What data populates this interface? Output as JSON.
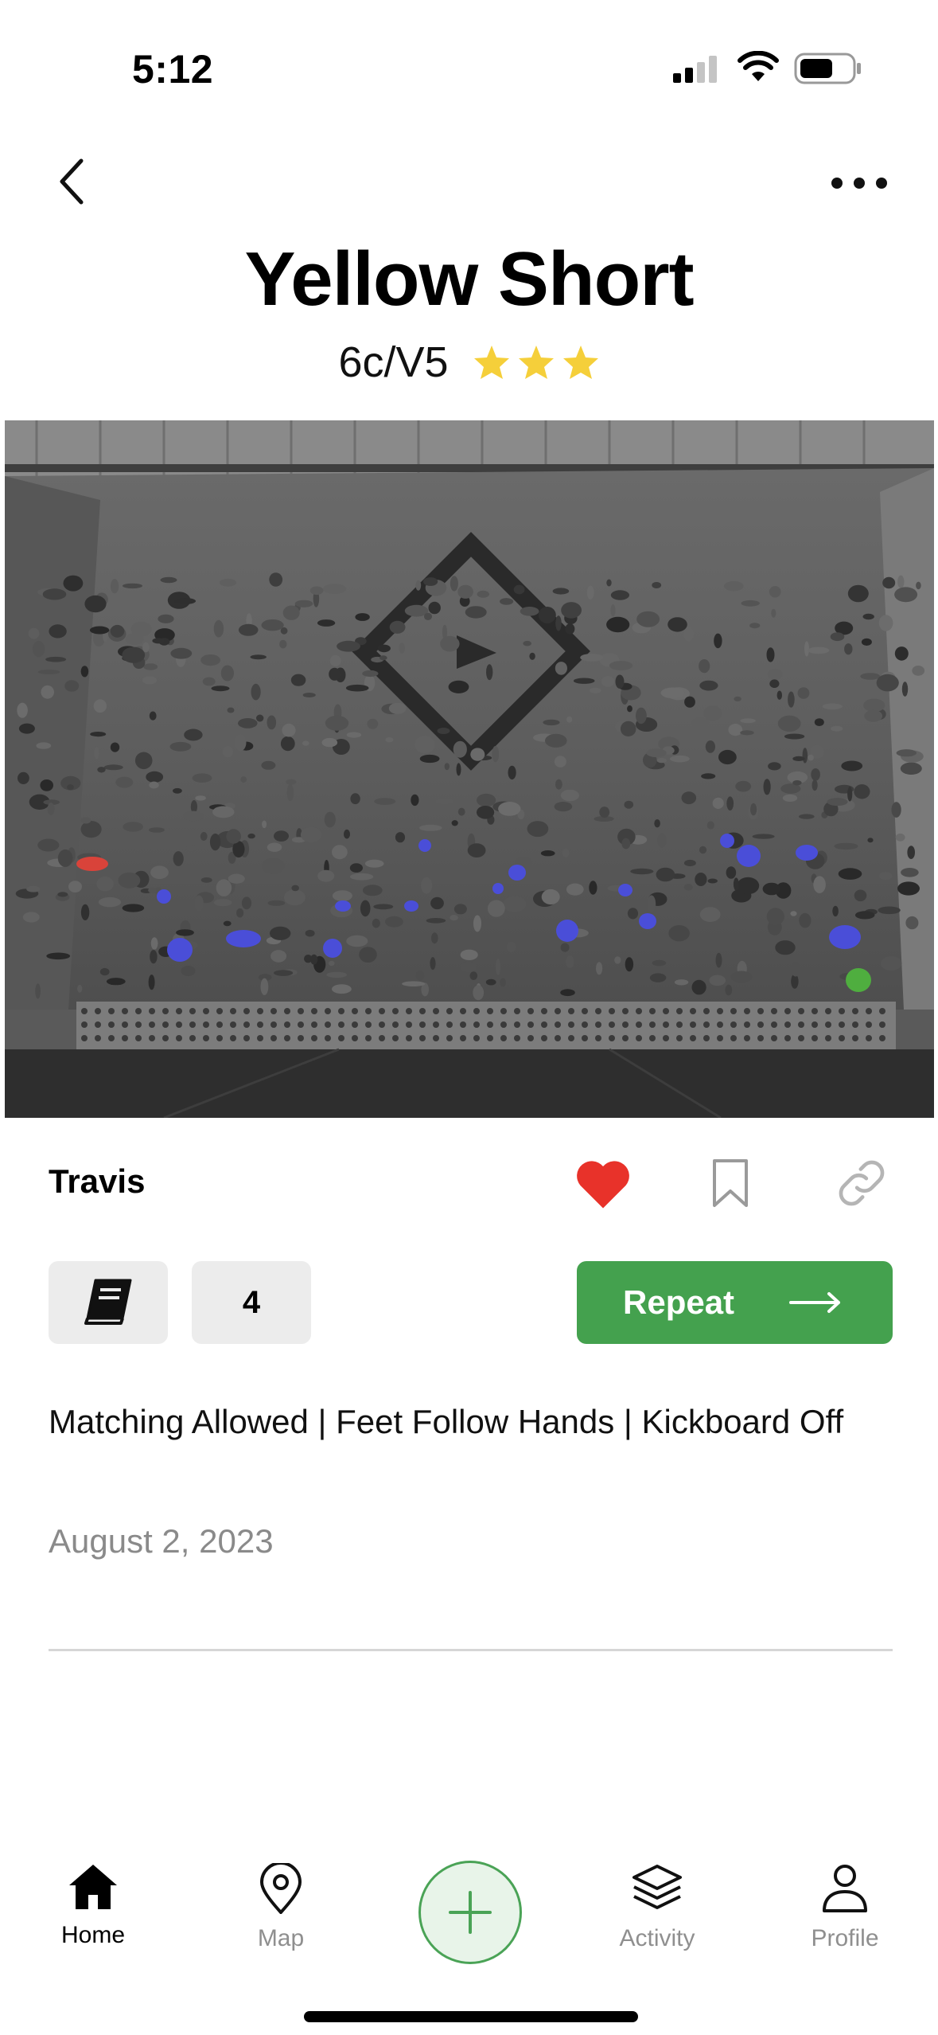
{
  "status_bar": {
    "time": "5:12"
  },
  "header": {
    "back_icon": "chevron-left-icon",
    "more_icon": "ellipsis-icon"
  },
  "problem": {
    "name": "Yellow Short",
    "grade": "6c/V5",
    "stars": 3
  },
  "setter": {
    "name": "Travis"
  },
  "actions": {
    "liked": true,
    "like_color": "#e8322a",
    "logbook_icon": "book-icon",
    "repeat_count": "4",
    "repeat_label": "Repeat"
  },
  "rules": {
    "text": "Matching Allowed  |  Feet Follow Hands  |  Kickboard Off"
  },
  "date": "August 2, 2023",
  "tabbar": {
    "items": [
      {
        "label": "Home",
        "icon": "house-icon",
        "active": true
      },
      {
        "label": "Map",
        "icon": "map-pin-icon",
        "active": false
      },
      {
        "label": "",
        "icon": "plus-icon",
        "active": false
      },
      {
        "label": "Activity",
        "icon": "layers-icon",
        "active": false
      },
      {
        "label": "Profile",
        "icon": "person-icon",
        "active": false
      }
    ]
  },
  "colors": {
    "accent_green": "#44a14e",
    "star_yellow": "#f5cf3a",
    "hold_blue": "#4a4ed8",
    "start_hold_red": "#d9433a",
    "finish_hold_green": "#4fae3f"
  }
}
